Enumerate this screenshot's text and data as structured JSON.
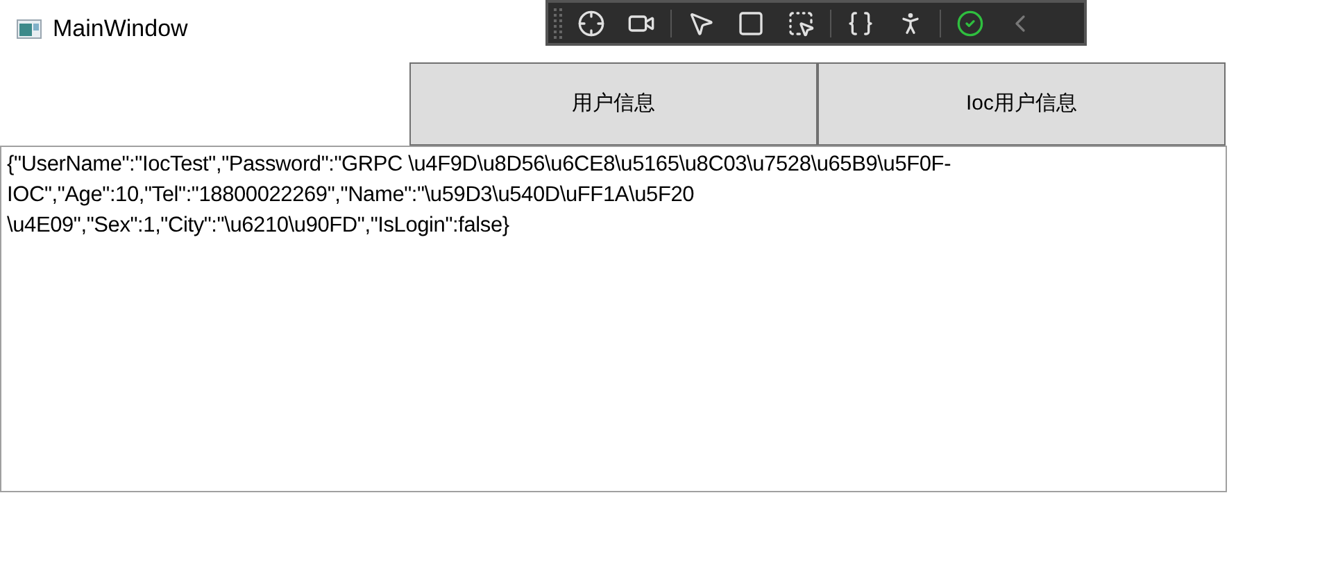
{
  "window": {
    "title": "MainWindow"
  },
  "buttons": [
    "用户信息",
    "Ioc用户信息"
  ],
  "output": {
    "lines": [
      "{\"UserName\":\"IocTest\",\"Password\":\"GRPC \\u4F9D\\u8D56\\u6CE8\\u5165\\u8C03\\u7528\\u65B9\\u5F0F-",
      "IOC\",\"Age\":10,\"Tel\":\"18800022269\",\"Name\":\"\\u59D3\\u540D\\uFF1A\\u5F20",
      "\\u4E09\",\"Sex\":1,\"City\":\"\\u6210\\u90FD\",\"IsLogin\":false}"
    ]
  }
}
